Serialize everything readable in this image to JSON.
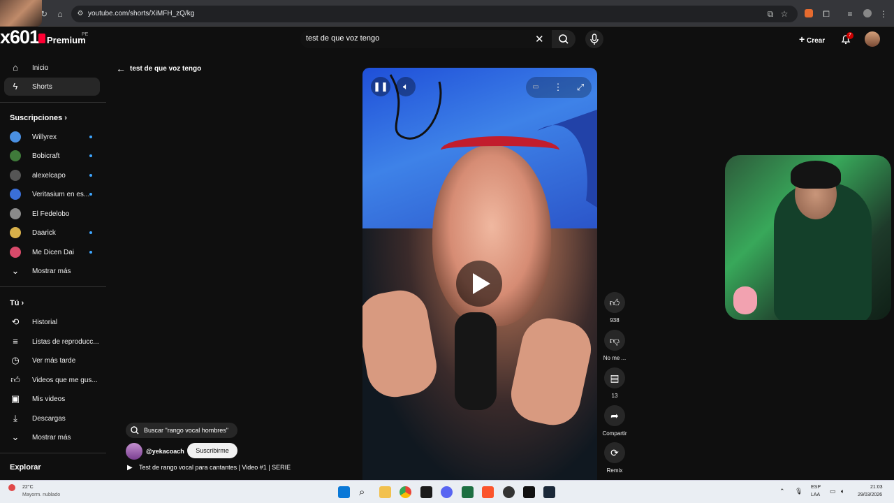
{
  "browser": {
    "url": "youtube.com/shorts/XiMFH_zQ/kg"
  },
  "brand": {
    "number": "x601",
    "premium": "Premium",
    "region": "PE"
  },
  "search": {
    "query": "test de que voz tengo"
  },
  "header": {
    "create_label": "Crear",
    "notifications_count": "7"
  },
  "sidebar": {
    "primary": [
      {
        "label": "Inicio",
        "icon": "home-icon"
      },
      {
        "label": "Shorts",
        "icon": "shorts-icon"
      }
    ],
    "subscriptions_heading": "Suscripciones",
    "subscriptions": [
      {
        "label": "Willyrex",
        "color": "#4a90e2",
        "new": true
      },
      {
        "label": "Bobicraft",
        "color": "#3f7a3a",
        "new": true
      },
      {
        "label": "alexelcapo",
        "color": "#555555",
        "new": true
      },
      {
        "label": "Veritasium en es...",
        "color": "#3a6fd8",
        "new": true
      },
      {
        "label": "El Fedelobo",
        "color": "#8a8a8a",
        "new": false
      },
      {
        "label": "Daarick",
        "color": "#d8b04a",
        "new": true
      },
      {
        "label": "Me Dicen Dai",
        "color": "#d84a6a",
        "new": true
      }
    ],
    "show_more_1": "Mostrar más",
    "you_heading": "Tú",
    "you_items": [
      {
        "label": "Historial",
        "icon": "history-icon"
      },
      {
        "label": "Listas de reproducc...",
        "icon": "playlist-icon"
      },
      {
        "label": "Ver más tarde",
        "icon": "clock-icon"
      },
      {
        "label": "Videos que me gus...",
        "icon": "thumbs-up-icon"
      },
      {
        "label": "Mis videos",
        "icon": "my-videos-icon"
      },
      {
        "label": "Descargas",
        "icon": "download-icon"
      }
    ],
    "show_more_2": "Mostrar más",
    "explore_heading": "Explorar"
  },
  "page": {
    "back_title": "test de que voz tengo"
  },
  "actions": {
    "like_count": "938",
    "dislike_label": "No me ...",
    "comments_count": "13",
    "share_label": "Compartir",
    "remix_label": "Remix"
  },
  "short": {
    "search_suggestion": "Buscar \"rango vocal hombres\"",
    "channel": "@yekacoach",
    "subscribe_label": "Suscribirme",
    "title": "Test de rango vocal para cantantes | Video #1 | SERIE"
  },
  "taskbar": {
    "weather_temp": "22°C",
    "weather_desc": "Mayorm. nublado",
    "lang": "ESP",
    "lang_region": "LAA",
    "time": "21:03",
    "date": "29/03/2026"
  }
}
